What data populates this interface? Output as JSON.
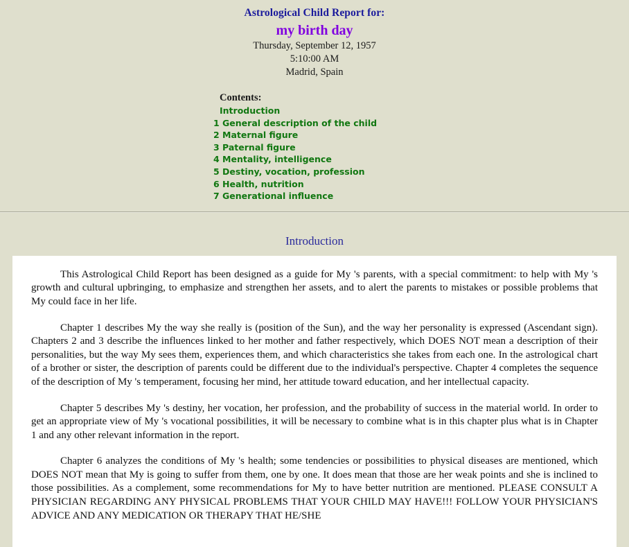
{
  "header": {
    "report_title": "Astrological Child Report for:",
    "person_name": "my birth day",
    "birth_date": "Thursday, September 12, 1957",
    "birth_time": "5:10:00 AM",
    "birth_place": "Madrid, Spain"
  },
  "contents": {
    "label": "Contents:",
    "items": [
      {
        "label": "Introduction"
      },
      {
        "label": "1 General description of the child"
      },
      {
        "label": "2 Maternal figure"
      },
      {
        "label": "3 Paternal figure"
      },
      {
        "label": "4 Mentality, intelligence"
      },
      {
        "label": "5 Destiny, vocation, profession"
      },
      {
        "label": "6 Health, nutrition"
      },
      {
        "label": "7 Generational influence"
      }
    ]
  },
  "section": {
    "heading": "Introduction",
    "paragraphs": [
      "This Astrological Child Report has been designed as a guide for My 's parents, with a special commitment: to help with My 's growth and cultural upbringing, to emphasize and strengthen her assets, and to alert the parents to mistakes or possible problems that My could face in her life.",
      "Chapter 1 describes My the way she really is (position of the Sun), and the way her personality is expressed (Ascendant sign). Chapters 2 and 3 describe the influences linked to her mother and father respectively, which DOES NOT mean a description of their personalities, but the way My sees them, experiences them, and which characteristics she takes from each one. In the astrological chart of a brother or sister, the description of parents could be different due to the individual's perspective. Chapter 4 completes the sequence of the description of My 's temperament, focusing her mind, her attitude toward education, and her intellectual capacity.",
      "Chapter 5 describes My 's destiny, her vocation, her profession, and the probability of success in the material world. In order to get an appropriate view of My 's vocational possibilities, it will be necessary to combine what is in this chapter plus what is in Chapter 1 and any other relevant information in the report.",
      "Chapter 6 analyzes the conditions of My 's health; some tendencies or possibilities to physical diseases are mentioned, which DOES NOT mean that My is going to suffer from them, one by one. It does mean that those are her weak points and she is inclined to those possibilities. As a complement, some recommendations for My to have better nutrition are mentioned. PLEASE CONSULT A PHYSICIAN REGARDING ANY PHYSICAL PROBLEMS THAT YOUR CHILD MAY HAVE!!! FOLLOW YOUR PHYSICIAN'S ADVICE AND ANY MEDICATION OR THERAPY THAT HE/SHE"
    ]
  },
  "colors": {
    "page_background": "#dfdfcd",
    "title_navy": "#1a1a9c",
    "name_purple": "#8000e0",
    "toc_green": "#117711",
    "heading_blue": "#2a2a9c",
    "panel_white": "#ffffff"
  }
}
